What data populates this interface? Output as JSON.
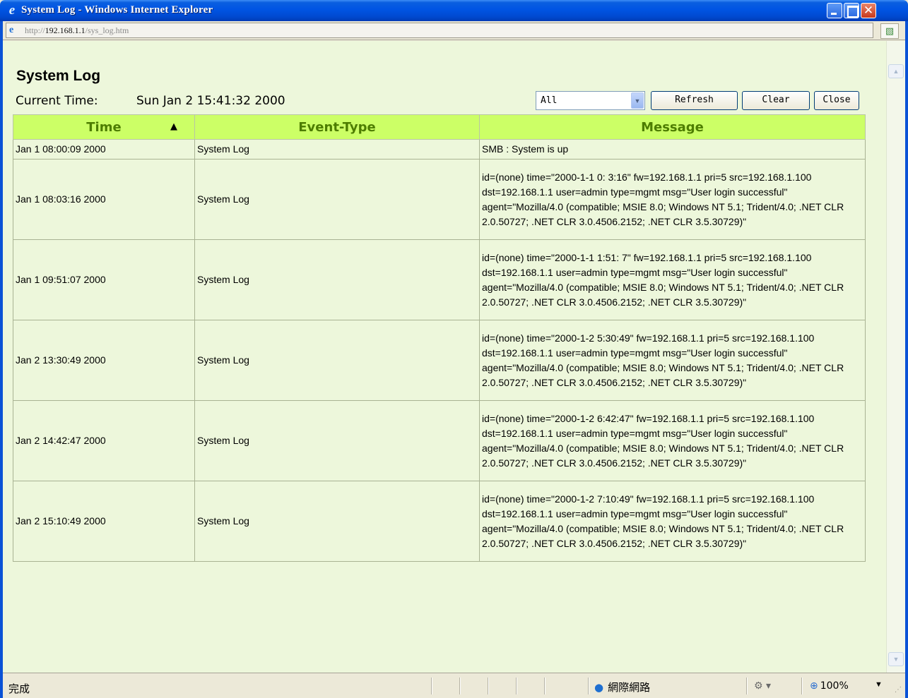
{
  "window": {
    "title": "System Log - Windows Internet Explorer",
    "url_prefix": "http://",
    "url_host": "192.168.1.1",
    "url_path": "/sys_log.htm"
  },
  "page": {
    "title": "System Log",
    "current_time_label": "Current Time:",
    "current_time_value": "Sun Jan 2 15:41:32 2000",
    "filter_value": "All",
    "buttons": {
      "refresh": "Refresh",
      "clear": "Clear",
      "close": "Close"
    }
  },
  "table": {
    "columns": [
      "Time",
      "Event-Type",
      "Message"
    ],
    "sort_indicator": "▲",
    "rows": [
      {
        "time": "Jan 1 08:00:09 2000",
        "event": "System Log",
        "message": "SMB : System is up"
      },
      {
        "time": "Jan 1 08:03:16 2000",
        "event": "System Log",
        "message": "id=(none) time=\"2000-1-1 0: 3:16\" fw=192.168.1.1 pri=5 src=192.168.1.100 dst=192.168.1.1 user=admin type=mgmt msg=\"User login successful\" agent=\"Mozilla/4.0 (compatible; MSIE 8.0; Windows NT 5.1; Trident/4.0; .NET CLR 2.0.50727; .NET CLR 3.0.4506.2152; .NET CLR 3.5.30729)\""
      },
      {
        "time": "Jan 1 09:51:07 2000",
        "event": "System Log",
        "message": "id=(none) time=\"2000-1-1 1:51: 7\" fw=192.168.1.1 pri=5 src=192.168.1.100 dst=192.168.1.1 user=admin type=mgmt msg=\"User login successful\" agent=\"Mozilla/4.0 (compatible; MSIE 8.0; Windows NT 5.1; Trident/4.0; .NET CLR 2.0.50727; .NET CLR 3.0.4506.2152; .NET CLR 3.5.30729)\""
      },
      {
        "time": "Jan 2 13:30:49 2000",
        "event": "System Log",
        "message": "id=(none) time=\"2000-1-2 5:30:49\" fw=192.168.1.1 pri=5 src=192.168.1.100 dst=192.168.1.1 user=admin type=mgmt msg=\"User login successful\" agent=\"Mozilla/4.0 (compatible; MSIE 8.0; Windows NT 5.1; Trident/4.0; .NET CLR 2.0.50727; .NET CLR 3.0.4506.2152; .NET CLR 3.5.30729)\""
      },
      {
        "time": "Jan 2 14:42:47 2000",
        "event": "System Log",
        "message": "id=(none) time=\"2000-1-2 6:42:47\" fw=192.168.1.1 pri=5 src=192.168.1.100 dst=192.168.1.1 user=admin type=mgmt msg=\"User login successful\" agent=\"Mozilla/4.0 (compatible; MSIE 8.0; Windows NT 5.1; Trident/4.0; .NET CLR 2.0.50727; .NET CLR 3.0.4506.2152; .NET CLR 3.5.30729)\""
      },
      {
        "time": "Jan 2 15:10:49 2000",
        "event": "System Log",
        "message": "id=(none) time=\"2000-1-2 7:10:49\" fw=192.168.1.1 pri=5 src=192.168.1.100 dst=192.168.1.1 user=admin type=mgmt msg=\"User login successful\" agent=\"Mozilla/4.0 (compatible; MSIE 8.0; Windows NT 5.1; Trident/4.0; .NET CLR 2.0.50727; .NET CLR 3.0.4506.2152; .NET CLR 3.5.30729)\""
      }
    ]
  },
  "status": {
    "text": "完成",
    "zone": "網際網路",
    "zoom": "100%"
  },
  "colors": {
    "page_bg": "#EDF7DB",
    "header_bg": "#CCFF66",
    "header_text": "#4d7d00"
  },
  "icons": {
    "title": "ie-logo-icon",
    "address": "ie-page-icon",
    "compat": "compatibility-view-icon",
    "zone": "globe-icon",
    "protected": "protected-mode-icon",
    "zoom": "zoom-icon"
  }
}
